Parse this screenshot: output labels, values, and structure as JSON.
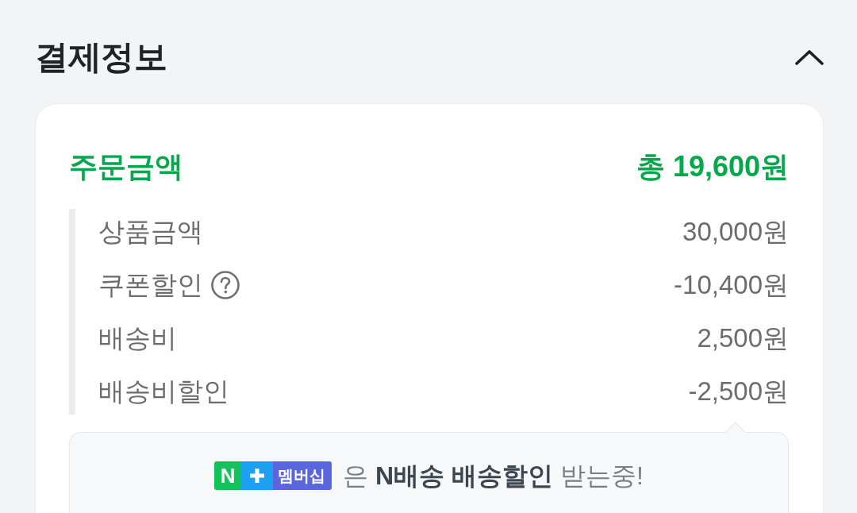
{
  "section": {
    "title": "결제정보",
    "expanded": true
  },
  "order_total": {
    "label": "주문금액",
    "value": "총 19,600원"
  },
  "breakdown": [
    {
      "label": "상품금액",
      "value": "30,000원",
      "help": false
    },
    {
      "label": "쿠폰할인",
      "value": "-10,400원",
      "help": true
    },
    {
      "label": "배송비",
      "value": "2,500원",
      "help": false
    },
    {
      "label": "배송비할인",
      "value": "-2,500원",
      "help": false
    }
  ],
  "banner": {
    "badge": {
      "letter": "N",
      "label": "멤버십"
    },
    "text": "은 **N배송 배송할인** 받는중!"
  }
}
